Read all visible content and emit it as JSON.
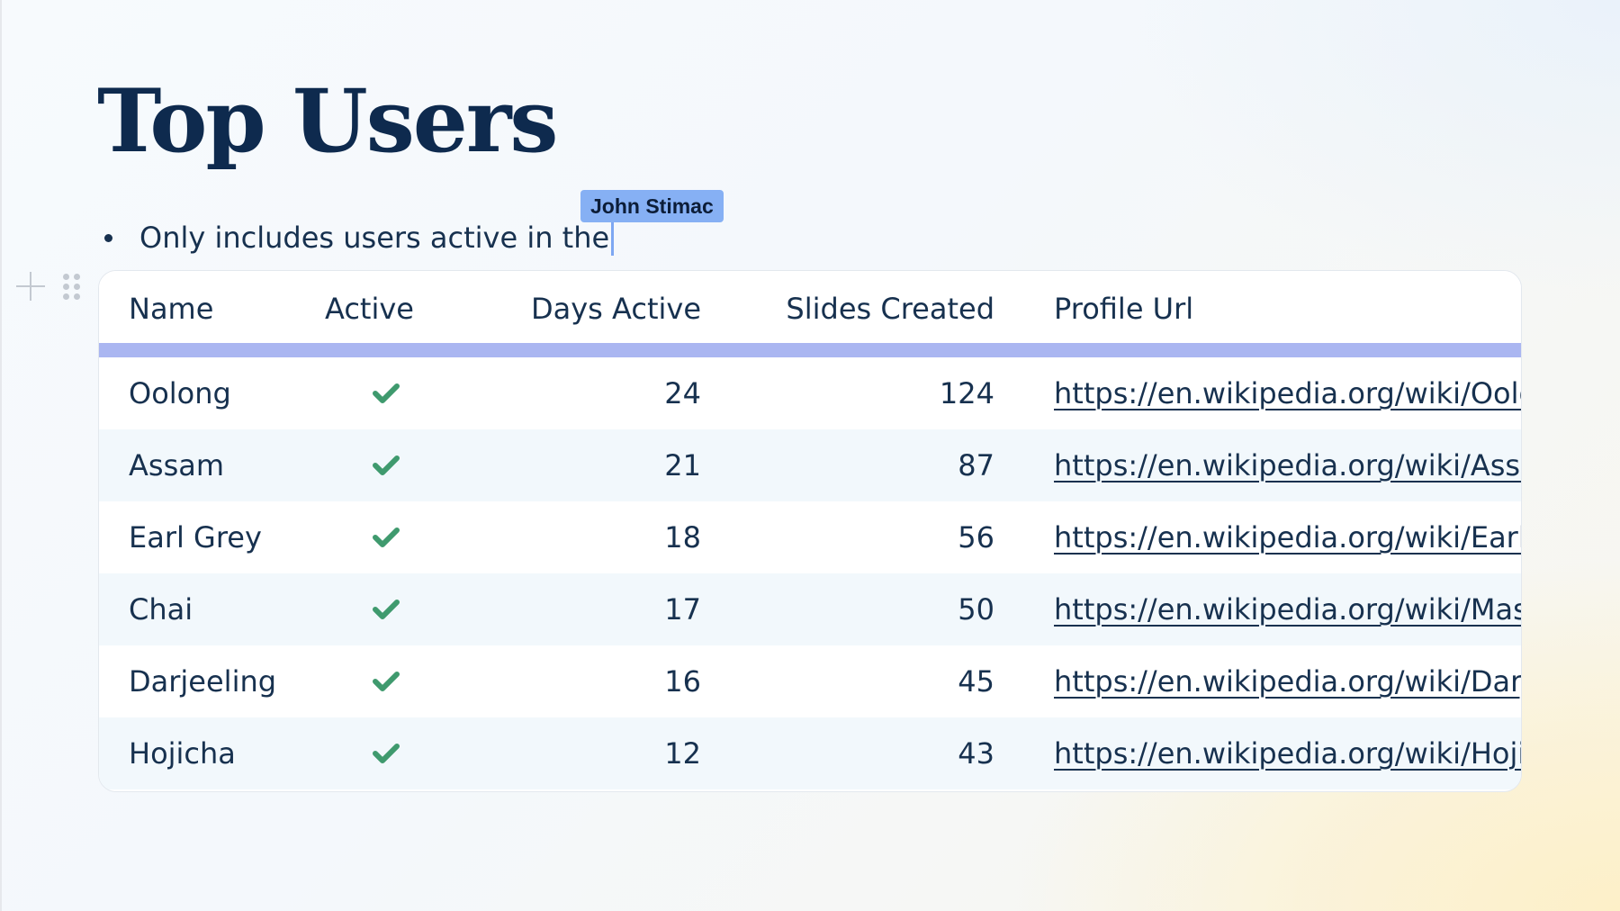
{
  "slide": {
    "title": "Top Users",
    "bullet_text": "Only includes users active in the",
    "collaborator_name": "John Stimac"
  },
  "colors": {
    "title": "#0e2a4e",
    "text": "#17314f",
    "header_bar": "#aab6f1",
    "alt_row": "#f2f8fc",
    "check": "#3f9a6e",
    "collaborator_tag": "#86b0f4"
  },
  "table": {
    "headers": {
      "name": "Name",
      "active": "Active",
      "days_active": "Days Active",
      "slides_created": "Slides Created",
      "profile_url": "Profile Url"
    },
    "rows": [
      {
        "name": "Oolong",
        "active": true,
        "days_active": "24",
        "slides_created": "124",
        "profile_url": "https://en.wikipedia.org/wiki/Oolong"
      },
      {
        "name": "Assam",
        "active": true,
        "days_active": "21",
        "slides_created": "87",
        "profile_url": "https://en.wikipedia.org/wiki/Assam_tea"
      },
      {
        "name": "Earl Grey",
        "active": true,
        "days_active": "18",
        "slides_created": "56",
        "profile_url": "https://en.wikipedia.org/wiki/Earl_Grey_tea"
      },
      {
        "name": "Chai",
        "active": true,
        "days_active": "17",
        "slides_created": "50",
        "profile_url": "https://en.wikipedia.org/wiki/Masala_chai"
      },
      {
        "name": "Darjeeling",
        "active": true,
        "days_active": "16",
        "slides_created": "45",
        "profile_url": "https://en.wikipedia.org/wiki/Darjeeling_tea"
      },
      {
        "name": "Hojicha",
        "active": true,
        "days_active": "12",
        "slides_created": "43",
        "profile_url": "https://en.wikipedia.org/wiki/Hojicha"
      }
    ]
  },
  "icons": {
    "add": "plus-icon",
    "drag": "drag-handle-icon",
    "active": "checkmark-icon"
  }
}
